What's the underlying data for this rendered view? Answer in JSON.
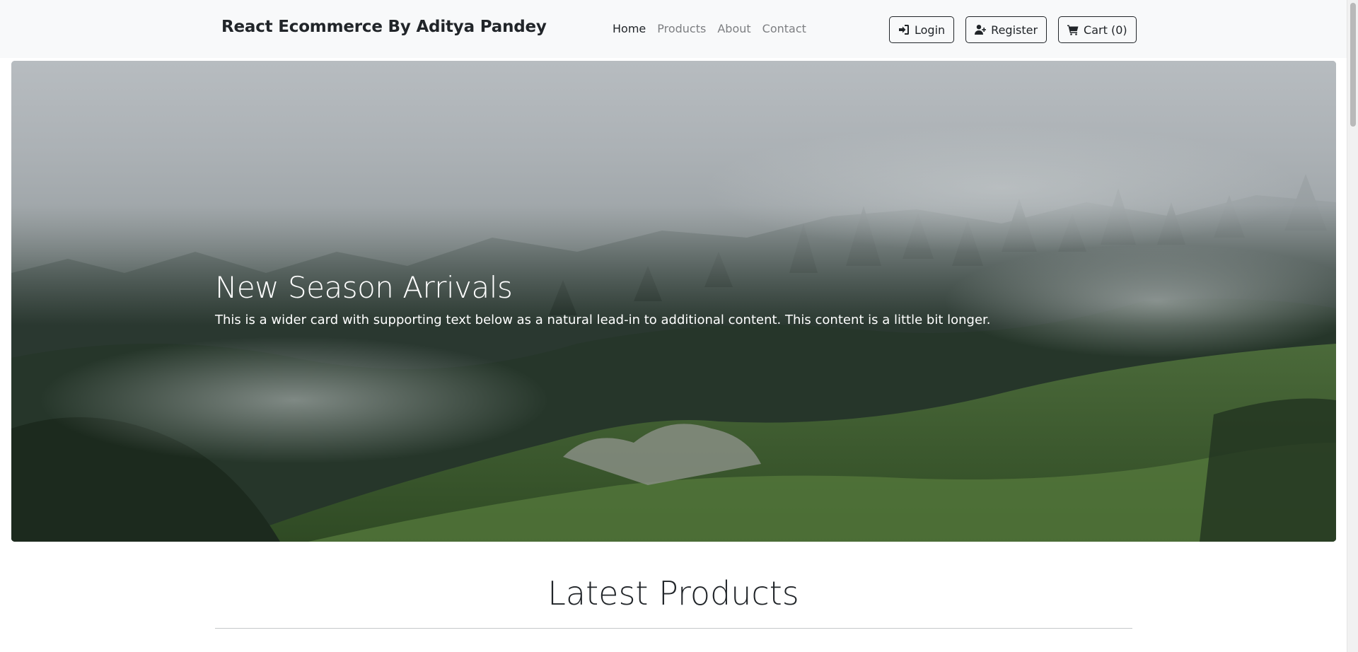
{
  "navbar": {
    "brand": "React Ecommerce By Aditya Pandey",
    "links": [
      {
        "label": "Home",
        "active": true
      },
      {
        "label": "Products",
        "active": false
      },
      {
        "label": "About",
        "active": false
      },
      {
        "label": "Contact",
        "active": false
      }
    ],
    "buttons": {
      "login": {
        "label": "Login",
        "icon": "sign-in-icon"
      },
      "register": {
        "label": "Register",
        "icon": "user-plus-icon"
      },
      "cart": {
        "label": "Cart (0)",
        "icon": "shopping-cart-icon"
      }
    }
  },
  "hero": {
    "title": "New Season Arrivals",
    "text": "This is a wider card with supporting text below as a natural lead-in to additional content. This content is a little bit longer."
  },
  "products": {
    "heading": "Latest Products"
  },
  "colors": {
    "navbar_bg": "#f8f9fa",
    "text_dark": "#212529",
    "nav_muted": "#7d7f82"
  }
}
